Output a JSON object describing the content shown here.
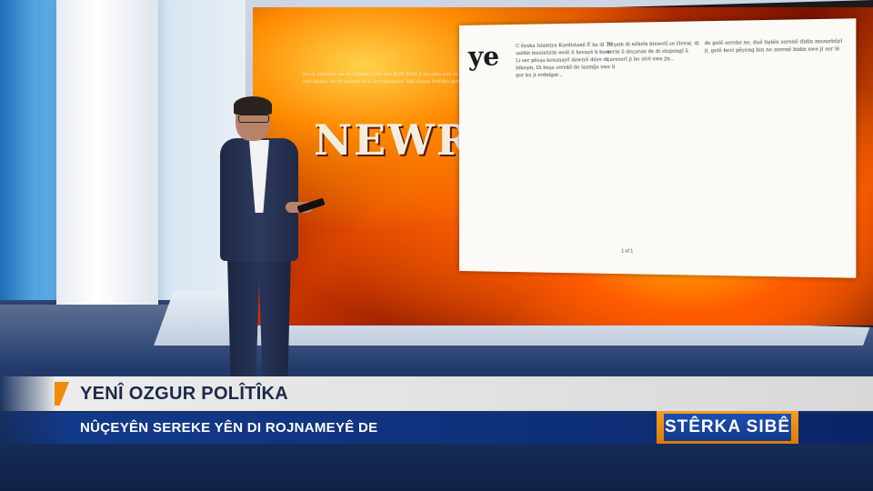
{
  "screen": {
    "title_word": "NEWROZ"
  },
  "newspaper": {
    "headline_fragment": "ye",
    "page_label": "1 of 1",
    "columns": [
      "C êyaka Islamiya Kurdistanê Ê ka di 70 saldin mezintirin welê li hevayê b bere. Li ser pêeşa koxunayê dawiyê dêye di bikeşin, Di beşa serekê de lazmîja xwe li gor ku ji erdnîgar...",
      "Rêşam di nêkrîn bixwetî se Heval, di evrin û deçaran de di stepengî û çareserî ji bo sivê xwe jiy...",
      "de gelê sereke ne, duê tiştên zerenê didin mezarbûyî ji, gelê hevi pêyeng bin ne zerenê bidin xwe ji ser lê"
    ]
  },
  "lower_third": {
    "headline": "YENÎ OZGUR POLÎTÎKA",
    "subline": "NÛÇEYÊN SEREKE YÊN DI ROJNAMEYÊ DE",
    "brand": "STÊRKA SIBÊ"
  }
}
